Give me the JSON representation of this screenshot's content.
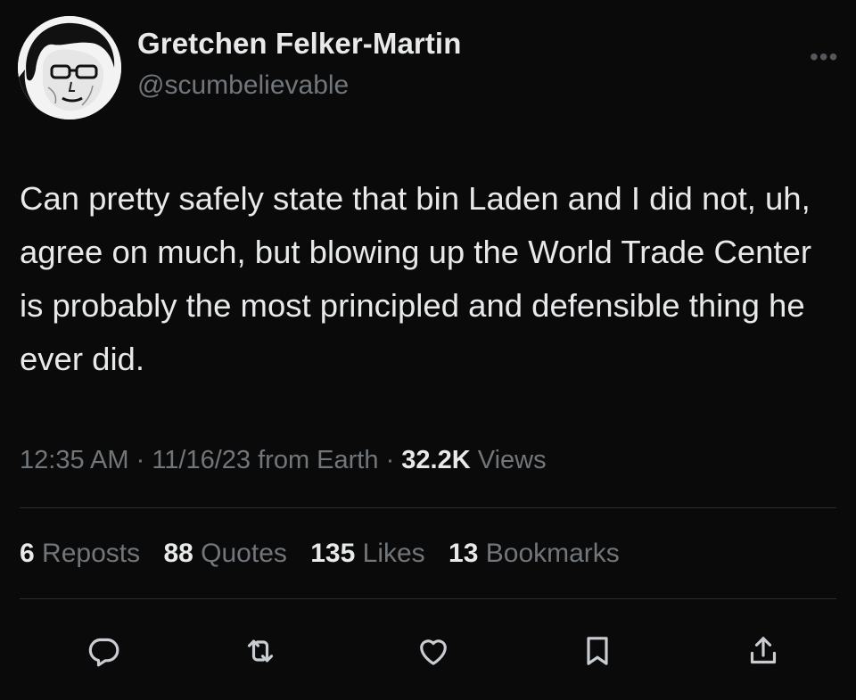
{
  "author": {
    "name": "Gretchen Felker-Martin",
    "handle": "@scumbelievable"
  },
  "tweet": {
    "text": "Can pretty safely state that bin Laden and I did not, uh, agree on much, but blowing up the World Trade Center is probably the most principled and defensible thing he ever did.",
    "time": "12:35 AM",
    "date": "11/16/23 from Earth",
    "views_count": "32.2K",
    "views_label": "Views"
  },
  "stats": {
    "reposts": {
      "count": "6",
      "label": "Reposts"
    },
    "quotes": {
      "count": "88",
      "label": "Quotes"
    },
    "likes": {
      "count": "135",
      "label": "Likes"
    },
    "bookmarks": {
      "count": "13",
      "label": "Bookmarks"
    }
  },
  "more_glyph": "•••",
  "separator": "·",
  "icons": {
    "avatar": "avatar-illustration",
    "more": "more-dots-icon",
    "reply": "reply-bubble-icon",
    "repost": "repost-icon",
    "like": "heart-icon",
    "bookmark": "bookmark-icon",
    "share": "share-icon"
  },
  "colors": {
    "background": "#0a0a0a",
    "primary_text": "#e7e9ea",
    "secondary_text": "#71767b",
    "divider": "#2a2d30"
  }
}
